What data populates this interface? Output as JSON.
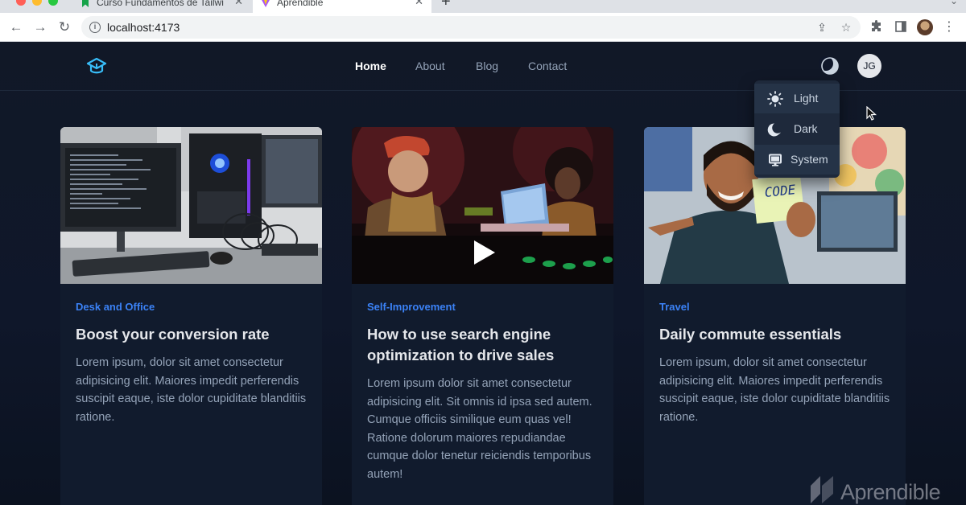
{
  "browser": {
    "tabs": [
      {
        "label": "Curso Fundamentos de Tailwi",
        "active": false
      },
      {
        "label": "Aprendible",
        "active": true
      }
    ],
    "url": "localhost:4173"
  },
  "site": {
    "nav": [
      {
        "label": "Home",
        "active": true
      },
      {
        "label": "About",
        "active": false
      },
      {
        "label": "Blog",
        "active": false
      },
      {
        "label": "Contact",
        "active": false
      }
    ],
    "avatar_initials": "JG",
    "theme_menu": [
      {
        "label": "Light",
        "icon": "sun-icon"
      },
      {
        "label": "Dark",
        "icon": "moon-icon"
      },
      {
        "label": "System",
        "icon": "monitor-icon"
      }
    ]
  },
  "cards": [
    {
      "category": "Desk and Office",
      "title": "Boost your conversion rate",
      "text": "Lorem ipsum, dolor sit amet consectetur adipisicing elit. Maiores impedit perferendis suscipit eaque, iste dolor cupiditate blanditiis ratione.",
      "image": "computer-desk-photo"
    },
    {
      "category": "Self-Improvement",
      "title": "How to use search engine optimization to drive sales",
      "text": "Lorem ipsum dolor sit amet consectetur adipisicing elit. Sit omnis id ipsa sed autem. Cumque officiis similique eum quas vel! Ratione dolorum maiores repudiandae cumque dolor tenetur reiciendis temporibus autem!",
      "image": "video-thumbnail-photo"
    },
    {
      "category": "Travel",
      "title": "Daily commute essentials",
      "text": "Lorem ipsum, dolor sit amet consectetur adipisicing elit. Maiores impedit perferendis suscipit eaque, iste dolor cupiditate blanditiis ratione.",
      "image": "developer-code-note-photo",
      "note_text": "CODE"
    }
  ],
  "watermark": "Aprendible",
  "colors": {
    "accent": "#3b82f6",
    "page_bg": "#0f172a",
    "card_bg": "#111b2d",
    "logo": "#38bdf8"
  }
}
